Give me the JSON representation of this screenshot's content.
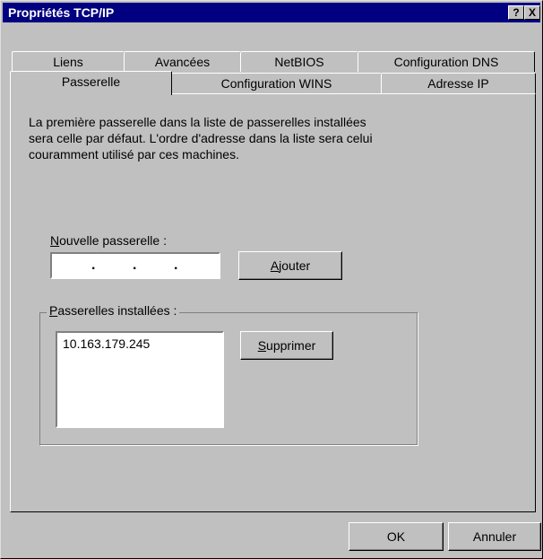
{
  "window": {
    "title": "Propriétés TCP/IP"
  },
  "titlebar": {
    "help": "?",
    "close": "X"
  },
  "tabs": {
    "back_row": [
      "Liens",
      "Avancées",
      "NetBIOS",
      "Configuration DNS"
    ],
    "front_row": [
      "Passerelle",
      "Configuration WINS",
      "Adresse IP"
    ],
    "selected": "Passerelle"
  },
  "panel": {
    "description": [
      "La première passerelle dans la liste de passerelles installées",
      "sera celle par défaut. L'ordre d'adresse dans la liste sera celui",
      "couramment utilisé par ces machines."
    ],
    "new_gateway": {
      "label_accel": "N",
      "label_rest": "ouvelle passerelle :",
      "value": "   .   .   .   ",
      "add_accel": "A",
      "add_rest": "jouter"
    },
    "installed": {
      "legend_accel": "P",
      "legend_rest": "asserelles installées :",
      "items": [
        "10.163.179.245"
      ],
      "remove_accel": "S",
      "remove_rest": "upprimer"
    }
  },
  "buttons": {
    "ok": "OK",
    "cancel": "Annuler"
  }
}
